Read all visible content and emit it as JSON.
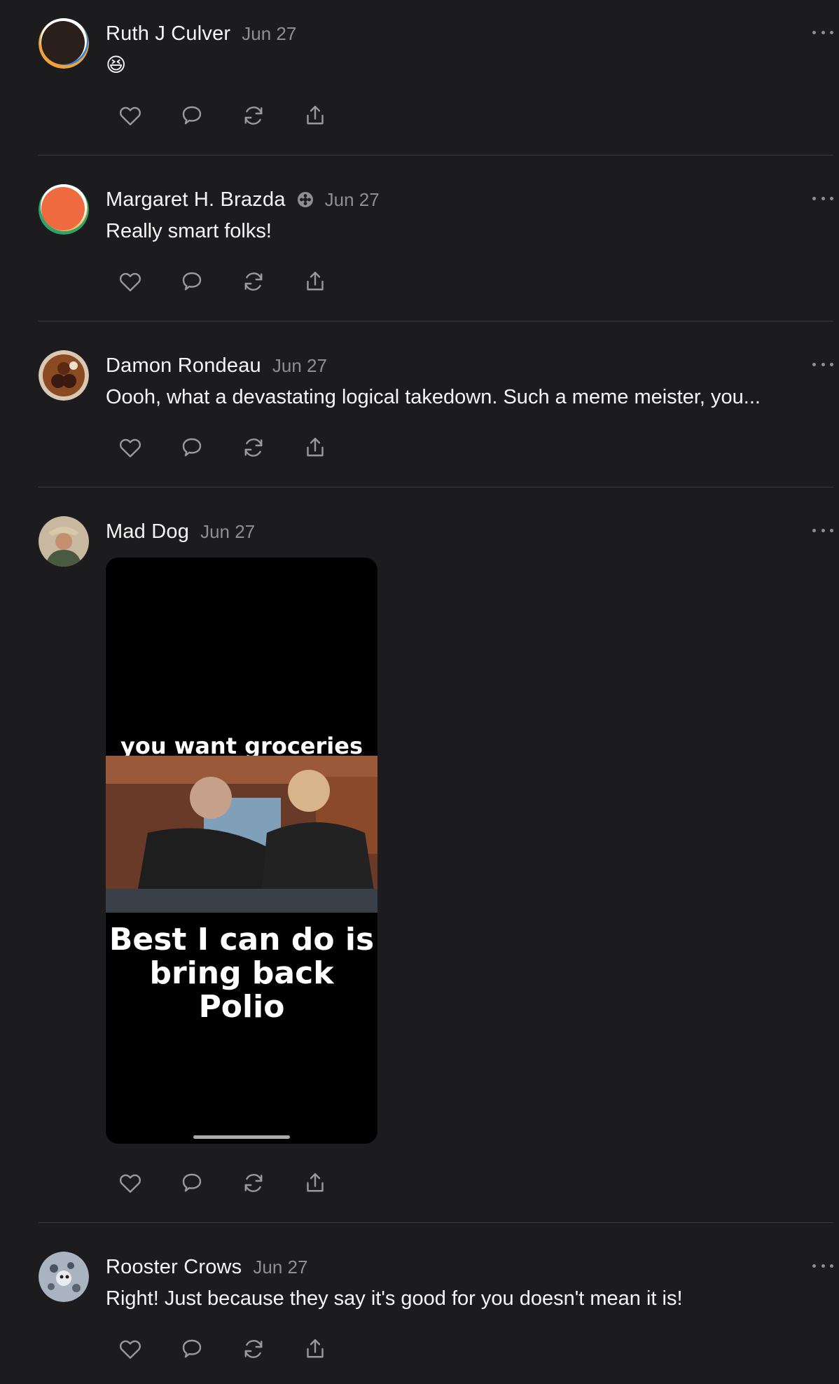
{
  "posts": [
    {
      "author": "Ruth J Culver",
      "date": "Jun 27",
      "text": "😆"
    },
    {
      "author": "Margaret H. Brazda",
      "date": "Jun 27",
      "badge": "flower-badge-icon",
      "text": "Really smart folks!"
    },
    {
      "author": "Damon Rondeau",
      "date": "Jun 27",
      "text": "Oooh, what a devastating logical takedown. Such a meme meister, you..."
    },
    {
      "author": "Mad Dog",
      "date": "Jun 27",
      "media": {
        "caption_top": "you want groceries\nto be cheaper?",
        "caption_bottom": "Best I can do is\nbring back Polio"
      }
    },
    {
      "author": "Rooster Crows",
      "date": "Jun 27",
      "text": "Right! Just because they say it's good for you doesn't mean it is!"
    }
  ],
  "icons": {
    "like": "heart-icon",
    "comment": "speech-bubble-icon",
    "restack": "refresh-arrows-icon",
    "share": "share-upload-icon",
    "more": "ellipsis-icon"
  },
  "colors": {
    "background": "#1c1c1e",
    "divider": "#3a3a3c",
    "muted": "#8e8e93"
  }
}
